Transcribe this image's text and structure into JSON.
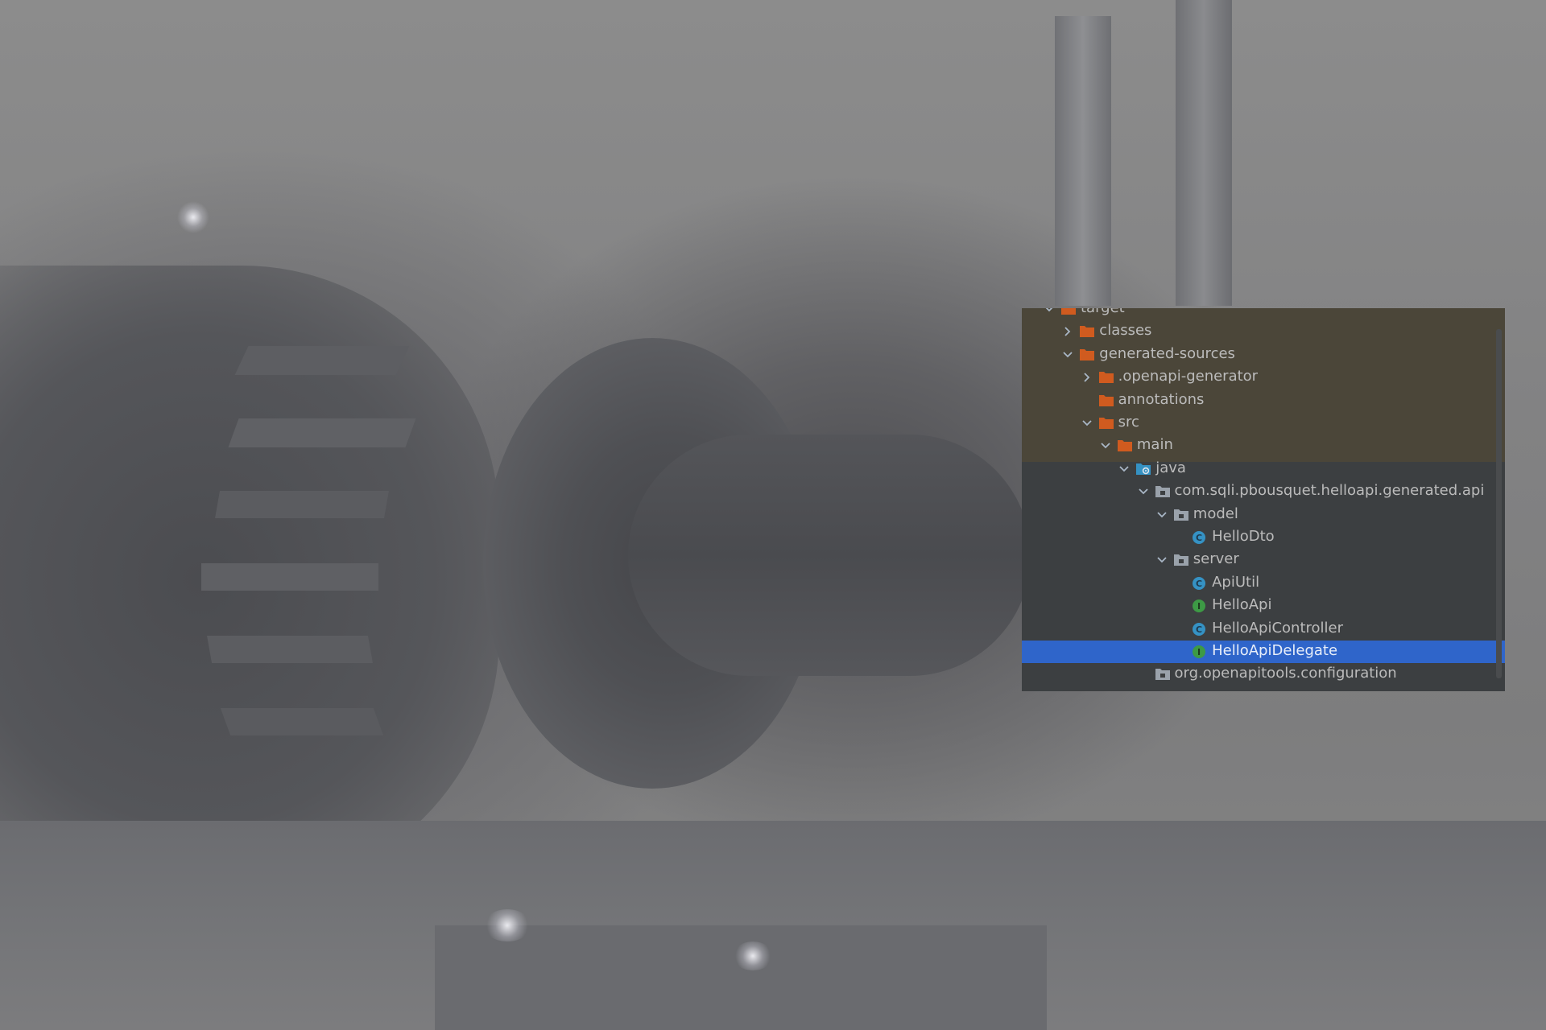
{
  "colors": {
    "panel_background": "#3c3f41",
    "excluded_highlight": "#4b4639",
    "selection": "#2f65ca",
    "excluded_folder": "#d05b1f",
    "package_folder": "#9aa2ab",
    "class_icon": "#3592c4",
    "interface_icon": "#3d9a45",
    "text": "#bbbbbb"
  },
  "project_tree": {
    "nodes": [
      {
        "label": "target",
        "icon": "excluded-folder-icon",
        "state": "expanded"
      },
      {
        "label": "classes",
        "icon": "excluded-folder-icon",
        "state": "collapsed"
      },
      {
        "label": "generated-sources",
        "icon": "excluded-folder-icon",
        "state": "expanded"
      },
      {
        "label": ".openapi-generator",
        "icon": "excluded-folder-icon",
        "state": "collapsed"
      },
      {
        "label": "annotations",
        "icon": "excluded-folder-icon",
        "state": "leaf"
      },
      {
        "label": "src",
        "icon": "excluded-folder-icon",
        "state": "expanded"
      },
      {
        "label": "main",
        "icon": "excluded-folder-icon",
        "state": "expanded"
      },
      {
        "label": "java",
        "icon": "generated-source-root-icon",
        "state": "expanded"
      },
      {
        "label": "com.sqli.pbousquet.helloapi.generated.api",
        "icon": "package-icon",
        "state": "expanded"
      },
      {
        "label": "model",
        "icon": "package-icon",
        "state": "expanded"
      },
      {
        "label": "HelloDto",
        "icon": "class-icon",
        "state": "leaf"
      },
      {
        "label": "server",
        "icon": "package-icon",
        "state": "expanded"
      },
      {
        "label": "ApiUtil",
        "icon": "class-icon",
        "state": "leaf"
      },
      {
        "label": "HelloApi",
        "icon": "interface-icon",
        "state": "leaf"
      },
      {
        "label": "HelloApiController",
        "icon": "class-icon",
        "state": "leaf"
      },
      {
        "label": "HelloApiDelegate",
        "icon": "interface-icon",
        "state": "leaf",
        "selected": true
      },
      {
        "label": "org.openapitools.configuration",
        "icon": "package-icon",
        "state": "leaf"
      }
    ]
  }
}
